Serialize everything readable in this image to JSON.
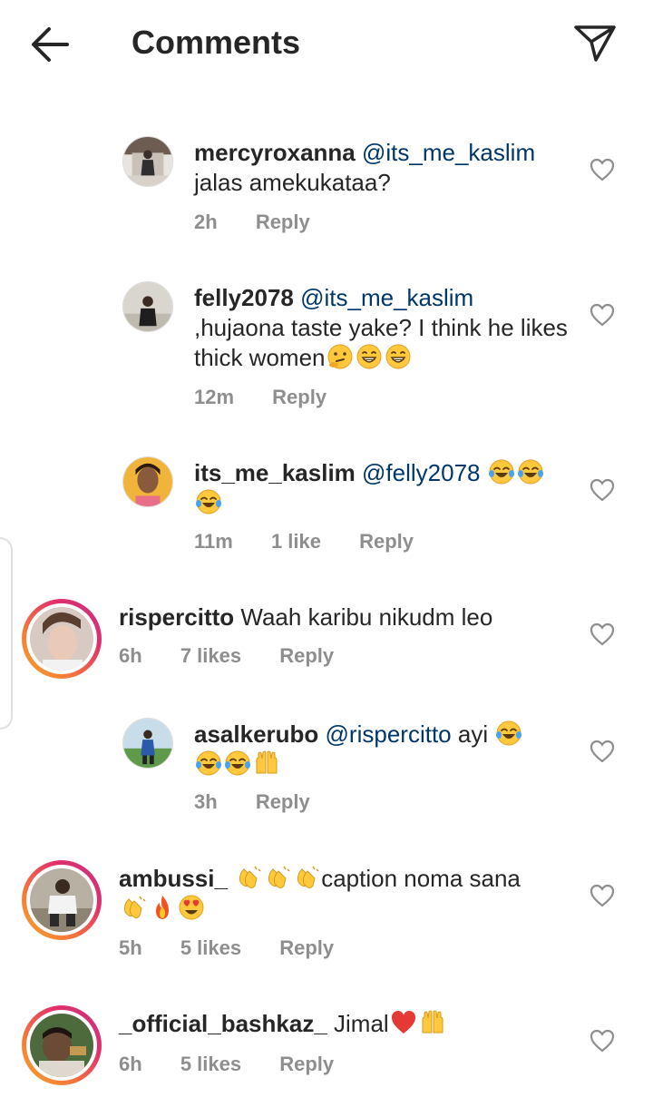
{
  "header": {
    "title": "Comments"
  },
  "comments": [
    {
      "username": "mercyroxanna",
      "mention": "@its_me_kaslim",
      "text": "jalas amekukataa?",
      "time": "2h",
      "likes": "",
      "reply": "Reply"
    },
    {
      "username": "felly2078",
      "mention": "@its_me_kaslim",
      "text": ",hujaona taste yake? I think he likes thick women",
      "time": "12m",
      "likes": "",
      "reply": "Reply"
    },
    {
      "username": "its_me_kaslim",
      "mention": "@felly2078",
      "text": "",
      "time": "11m",
      "likes": "1 like",
      "reply": "Reply"
    },
    {
      "username": "rispercitto",
      "mention": "",
      "text": "Waah karibu nikudm leo",
      "time": "6h",
      "likes": "7 likes",
      "reply": "Reply"
    },
    {
      "username": "asalkerubo",
      "mention": "@rispercitto",
      "text": "ayi",
      "time": "3h",
      "likes": "",
      "reply": "Reply"
    },
    {
      "username": "ambussi_",
      "mention": "",
      "text": "caption noma sana",
      "time": "5h",
      "likes": "5 likes",
      "reply": "Reply"
    },
    {
      "username": "_official_bashkaz_",
      "mention": "",
      "text": "Jimal",
      "time": "6h",
      "likes": "5 likes",
      "reply": "Reply"
    }
  ],
  "colors": {
    "mention": "#00376b",
    "meta": "#8e8e8e",
    "text": "#262626"
  }
}
